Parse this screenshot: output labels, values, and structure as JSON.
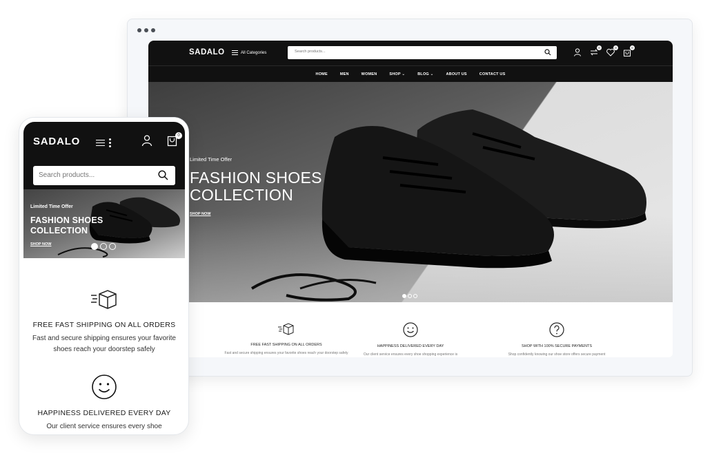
{
  "brand": "SADALO",
  "desktop": {
    "all_categories": "All Categories",
    "search_placeholder": "Search products...",
    "badges": {
      "compare": "0",
      "wishlist": "0",
      "cart": "0"
    },
    "nav": [
      "HOME",
      "MEN",
      "WOMEN",
      "SHOP",
      "BLOG",
      "ABOUT US",
      "CONTACT US"
    ],
    "hero": {
      "offer": "Limited Time Offer",
      "title_line1": "FASHION SHOES",
      "title_line2": "COLLECTION",
      "cta": "SHOP NOW",
      "active_slide": 1,
      "slide_count": 3
    },
    "features": [
      {
        "icon": "shipping-box-icon",
        "title": "FREE FAST SHIPPING ON ALL ORDERS",
        "desc": "Fast and secure shipping ensures your favorite shoes reach your doorstep safely"
      },
      {
        "icon": "smiley-icon",
        "title": "HAPPINESS DELIVERED EVERY DAY",
        "desc": "Our client service ensures every shoe shopping experience is"
      },
      {
        "icon": "question-icon",
        "title": "SHOP WITH 100% SECURE PAYMENTS",
        "desc": "Shop confidently knowing our shoe store offers secure payment"
      }
    ]
  },
  "mobile": {
    "search_placeholder": "Search products...",
    "cart_badge": "0",
    "hero": {
      "offer": "Limited Time Offer",
      "title_line1": "FASHION SHOES",
      "title_line2": "COLLECTION",
      "cta": "SHOP NOW",
      "active_slide": 1,
      "slide_count": 3
    },
    "features": [
      {
        "icon": "shipping-box-icon",
        "title": "FREE FAST SHIPPING ON ALL ORDERS",
        "desc": "Fast and secure shipping ensures your favorite shoes reach your doorstep safely"
      },
      {
        "icon": "smiley-icon",
        "title": "HAPPINESS DELIVERED EVERY DAY",
        "desc": "Our client service ensures every shoe"
      }
    ]
  },
  "colors": {
    "header_bg": "#111111",
    "accent": "#ffffff"
  }
}
